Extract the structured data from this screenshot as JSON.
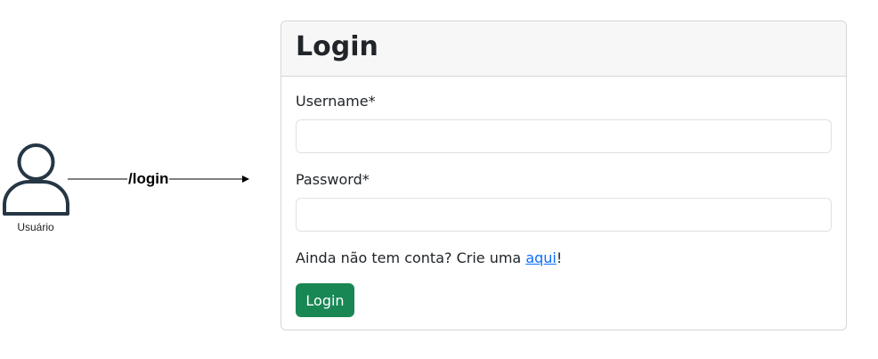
{
  "diagram": {
    "actor_label": "Usuário",
    "route_label": "/login",
    "actor_icon": "user-icon",
    "arrow_icon": "arrow-right-icon"
  },
  "card": {
    "title": "Login",
    "username_label": "Username*",
    "username_value": "",
    "password_label": "Password*",
    "password_value": "",
    "signup_text_before": "Ainda não tem conta? Crie uma ",
    "signup_link": "aqui",
    "signup_text_after": "!",
    "login_button": "Login"
  },
  "colors": {
    "primary_button": "#198754",
    "link": "#0d6efd",
    "header_bg": "#f7f7f7",
    "icon_stroke": "#263645"
  }
}
